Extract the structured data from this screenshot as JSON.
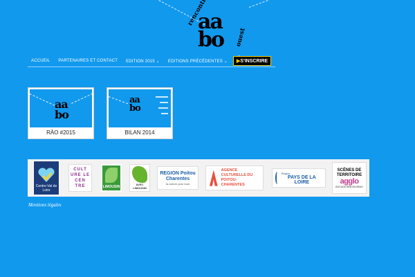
{
  "header": {
    "logo": {
      "word_top": "rencontres",
      "letters_top": "aa",
      "letters_bottom": "bo",
      "word_bottom": "ouest"
    }
  },
  "nav": {
    "items": [
      {
        "label": "Accueil"
      },
      {
        "label": "Partenaires et contact"
      },
      {
        "label": "Edition 2015 ⌄"
      },
      {
        "label": "Editions précédentes ⌄"
      }
    ],
    "cta": {
      "arrow": "▶",
      "label": "S'INSCRIRE"
    }
  },
  "cards": [
    {
      "caption": "RÀO #2015"
    },
    {
      "caption": "BILAN 2014"
    }
  ],
  "partners": [
    {
      "name": "Centre-Val de Loire"
    },
    {
      "name": "CULT URE LE CEN TRE"
    },
    {
      "name": "LIMOUSIN"
    },
    {
      "name": "AVEC LIMOUSIN"
    },
    {
      "name": "REGION Poitou Charentes",
      "sub": "la culture pour tous"
    },
    {
      "name": "AGENCE CULTURELLE DU POITOU-CHARENTES"
    },
    {
      "name": "PAYS DE LA LOIRE",
      "sub": "Région"
    },
    {
      "name": "SCÈNES DE TERRITOIRE",
      "brand": "agglo",
      "sub": "BOCAGE BRESSUIRAIS"
    }
  ],
  "footer": {
    "legal": "Mentions légales"
  },
  "colors": {
    "background": "#1199ee",
    "cta_border": "#ffcc00"
  }
}
